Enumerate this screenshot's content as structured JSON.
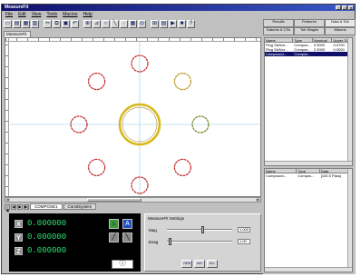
{
  "app": {
    "title": "MeasureFit",
    "window_buttons": [
      "_",
      "□",
      "×"
    ]
  },
  "menu": [
    "File",
    "Edit",
    "View",
    "Tools",
    "Macros",
    "Help"
  ],
  "toolbar": {
    "buttons": [
      {
        "name": "new-icon",
        "glyph": "▭"
      },
      {
        "name": "open-icon",
        "glyph": "▤"
      },
      {
        "name": "save-icon",
        "glyph": "▦"
      },
      {
        "name": "print-icon",
        "glyph": "▥"
      },
      {
        "name": "cut-icon",
        "glyph": "✂"
      },
      {
        "name": "copy-icon",
        "glyph": "⧉"
      },
      {
        "name": "paste-icon",
        "glyph": "▣"
      },
      {
        "name": "undo-icon",
        "glyph": "↶"
      },
      {
        "name": "zoom-icon",
        "glyph": "⊕"
      },
      {
        "name": "measure-icon",
        "glyph": "⊿"
      },
      {
        "name": "circle-icon",
        "glyph": "○"
      },
      {
        "name": "line-icon",
        "glyph": "╲"
      },
      {
        "name": "point-icon",
        "glyph": "·"
      },
      {
        "name": "grid-icon",
        "glyph": "▦"
      },
      {
        "name": "target-icon",
        "glyph": "◎"
      },
      {
        "name": "compose-icon",
        "glyph": "⊞"
      },
      {
        "name": "report-icon",
        "glyph": "▤"
      },
      {
        "name": "run-icon",
        "glyph": "▶"
      },
      {
        "name": "stop-icon",
        "glyph": "■"
      },
      {
        "name": "help-icon",
        "glyph": "?"
      }
    ]
  },
  "view": {
    "tab_label": "MeasureFit",
    "colors": {
      "outer_circle": "#c42a2a",
      "center_circle": "#d8b818",
      "alt_circle": "#b89820",
      "crosshair": "#8fc8e8"
    }
  },
  "canvas": {
    "outer_circles": [
      {
        "kind": "red"
      },
      {
        "kind": "gold"
      },
      {
        "kind": "green"
      },
      {
        "kind": "red"
      },
      {
        "kind": "red"
      },
      {
        "kind": "red"
      },
      {
        "kind": "red"
      },
      {
        "kind": "red"
      }
    ]
  },
  "document_tabs": {
    "nav": [
      "|◀",
      "◀",
      "▶",
      "▶|"
    ],
    "items": [
      {
        "label": "COMPOSE1",
        "active": true
      },
      {
        "label": "ConstSystem",
        "active": false
      }
    ]
  },
  "dro": {
    "rows": [
      {
        "axis": "X",
        "value": "0.000000"
      },
      {
        "axis": "Y",
        "value": "0.000000"
      },
      {
        "axis": "Z",
        "value": "0.000000"
      }
    ],
    "logo_text": "ⓘ"
  },
  "settings": {
    "title": "MeasureFit Settings",
    "rows": [
      {
        "label": "Mag",
        "value": "1.000",
        "level": 0.55
      },
      {
        "label": "Exag",
        "value": "1.00",
        "level": 0.03
      }
    ],
    "buttons": [
      "VIEW",
      "⊕⊖",
      "ALL"
    ]
  },
  "right_panel": {
    "top_tabs": [
      "Results",
      "Features",
      "Data & Tolr"
    ],
    "bottom_tabs": [
      "Datums & CSs",
      "Tolr Stages",
      "Macros"
    ],
    "features": {
      "columns": [
        "Name",
        "Type",
        "Nominal",
        "Upper Tol"
      ],
      "rows": [
        {
          "cells": [
            "Plug SizNor...",
            "Compos...",
            "0.5000",
            "0.0700"
          ],
          "selected": false
        },
        {
          "cells": [
            "Plug SizNor...",
            "Compos...",
            "2.5000",
            "0.0000"
          ],
          "selected": false
        },
        {
          "cells": [
            "Compound...",
            "Compos...",
            "",
            ""
          ],
          "selected": true
        }
      ]
    },
    "references": {
      "columns": [
        "Name",
        "Type",
        "Data"
      ],
      "rows": [
        {
          "cells": [
            "Compound...",
            "Compos...",
            "[100.5 Pass]"
          ],
          "selected": false
        }
      ]
    }
  }
}
